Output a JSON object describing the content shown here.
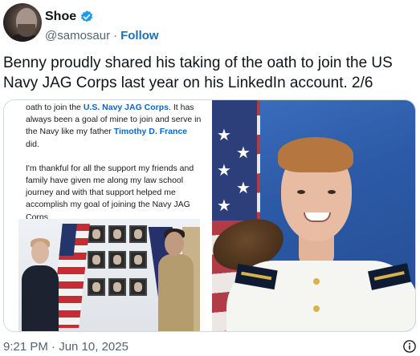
{
  "author": {
    "display_name": "Shoe",
    "handle": "@samosaur",
    "separator": "·",
    "follow_label": "Follow",
    "verified_icon": "verified-badge-icon"
  },
  "tweet": {
    "text": "Benny proudly shared his taking of the oath to join the US Navy JAG Corps last year on his LinkedIn account. 2/6"
  },
  "media": {
    "left_image": {
      "post_paragraph_1": {
        "pre": "oath to join the ",
        "highlight_1": "U.S. Navy JAG Corps",
        "mid": ". It has always been a goal of mine to join and serve in the Navy like my father ",
        "highlight_2": "Timothy D. France",
        "post": " did."
      },
      "post_paragraph_2": "I'm thankful for all the support my friends and family have given me along my law school journey and with that support helped me accomplish my goal of joining the Navy JAG Corps."
    }
  },
  "footer": {
    "timestamp": "9:21 PM · Jun 10, 2025",
    "info_icon": "info-icon"
  },
  "colors": {
    "follow": "#1d6fb8",
    "verified": "#1d9bf0",
    "linkedin_highlight": "#0a66c2",
    "muted": "#536471"
  }
}
